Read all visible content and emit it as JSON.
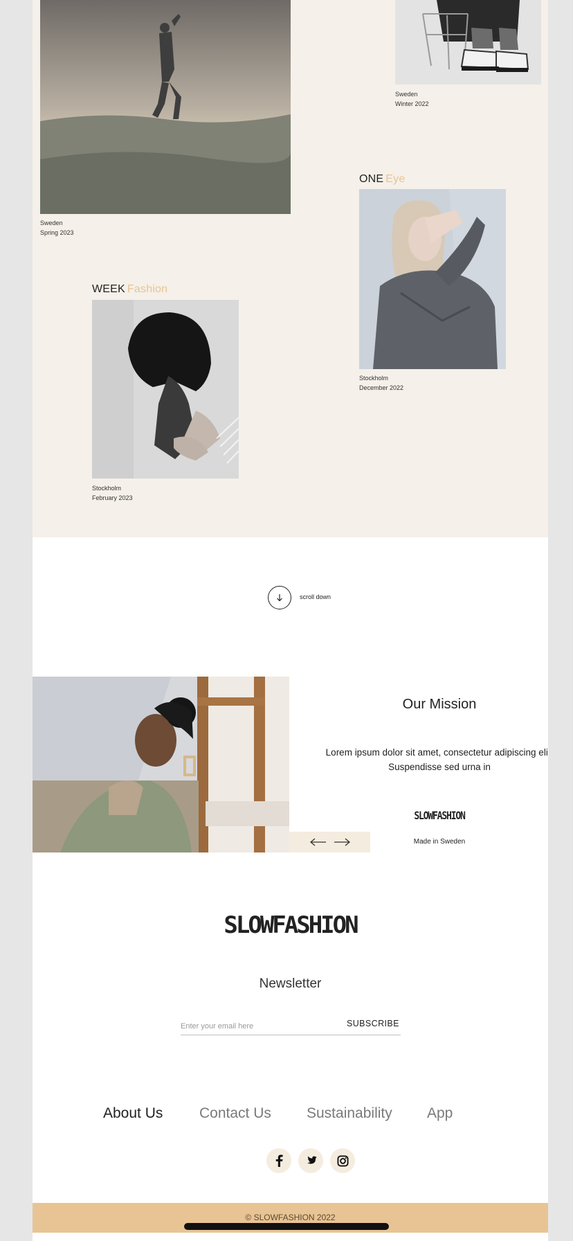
{
  "gallery": {
    "item1": {
      "location": "Sweden",
      "season": "Spring 2023"
    },
    "item2": {
      "location": "Sweden",
      "season": "Winter 2022"
    },
    "item3": {
      "title_main": "ONE",
      "title_accent": "Eye",
      "location": "Stockholm",
      "season": "December 2022"
    },
    "item4": {
      "title_main": "WEEK",
      "title_accent": "Fashion",
      "location": "Stockholm",
      "season": "February 2023"
    }
  },
  "scroll": {
    "label": "scroll down"
  },
  "mission": {
    "title": "Our Mission",
    "text": "Lorem ipsum dolor sit amet, consectetur adipiscing elit. Suspendisse sed urna in",
    "brand": "SLOWFASHION",
    "made_in": "Made in Sweden"
  },
  "newsletter": {
    "brand": "SLOWFASHION",
    "title": "Newsletter",
    "placeholder": "Enter your email here",
    "button": "SUBSCRIBE"
  },
  "nav": [
    "About Us",
    "Contact Us",
    "Sustainability",
    "App"
  ],
  "social": [
    "facebook-icon",
    "twitter-icon",
    "instagram-icon"
  ],
  "footer": {
    "copyright": "© SLOWFASHION 2022"
  },
  "colors": {
    "beige": "#f5f0e9",
    "accent": "#e8c494",
    "footer": "#e8c494"
  }
}
